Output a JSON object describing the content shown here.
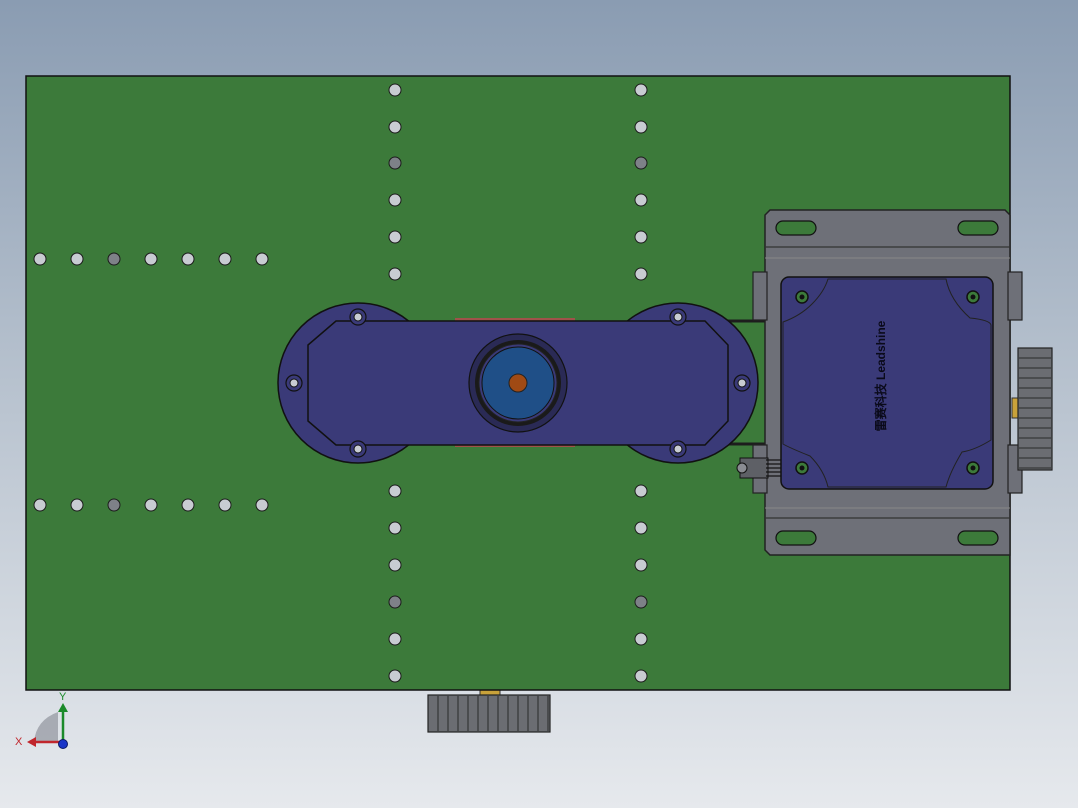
{
  "viewport": {
    "motor_label": "雷赛科技 Leadshine",
    "triad": {
      "x_label": "X",
      "y_label": "Y"
    }
  },
  "colors": {
    "plate": "#3c7a3a",
    "housing": "#3a3a78",
    "bracket": "#6e7078",
    "hole": "#c8ccd2",
    "x_axis": "#c0262c",
    "y_axis": "#1b8a2a"
  }
}
